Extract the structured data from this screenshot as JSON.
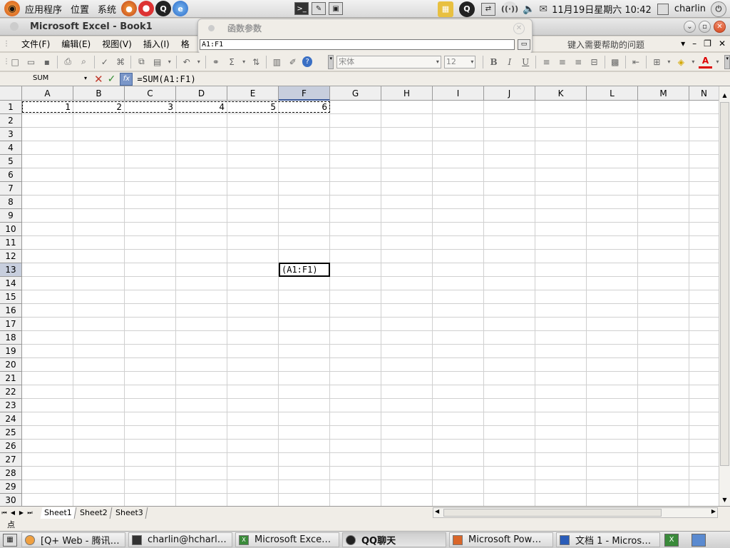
{
  "topbar": {
    "menus": [
      "应用程序",
      "位置",
      "系统"
    ],
    "clock": "11月19日星期六 10:42",
    "user": "charlin"
  },
  "window": {
    "title": "Microsoft Excel - Book1"
  },
  "function_args_panel": {
    "title": "函数参数",
    "input_value": "A1:F1"
  },
  "menubar": {
    "items": [
      "文件(F)",
      "编辑(E)",
      "视图(V)",
      "插入(I)",
      "格"
    ],
    "help_placeholder": "键入需要帮助的问题"
  },
  "toolbar": {
    "font_name": "宋体",
    "font_size": "12",
    "bold": "B",
    "italic": "I",
    "underline": "U"
  },
  "formula_bar": {
    "name_box": "SUM",
    "formula": "=SUM(A1:F1)"
  },
  "sheet": {
    "columns": [
      "A",
      "B",
      "C",
      "D",
      "E",
      "F",
      "G",
      "H",
      "I",
      "J",
      "K",
      "L",
      "M",
      "N"
    ],
    "selected_column": "F",
    "rows": [
      "1",
      "2",
      "3",
      "4",
      "5",
      "6",
      "7",
      "8",
      "9",
      "10",
      "11",
      "12",
      "13",
      "14",
      "15",
      "16",
      "17",
      "18",
      "19",
      "20",
      "21",
      "22",
      "23",
      "24",
      "25",
      "26",
      "27",
      "28",
      "29",
      "30"
    ],
    "selected_row": "13",
    "row1_values": [
      "1",
      "2",
      "3",
      "4",
      "5",
      "6"
    ],
    "edit_cell_text": "(A1:F1)"
  },
  "sheet_tabs": [
    "Sheet1",
    "Sheet2",
    "Sheet3"
  ],
  "status_text": "点",
  "taskbar": {
    "tasks": [
      "[Q+ Web - 腾讯…",
      "charlin@hcharl…",
      "Microsoft Exce…",
      "QQ聊天",
      "Microsoft Pow…",
      "文档 1 - Micros…"
    ]
  }
}
